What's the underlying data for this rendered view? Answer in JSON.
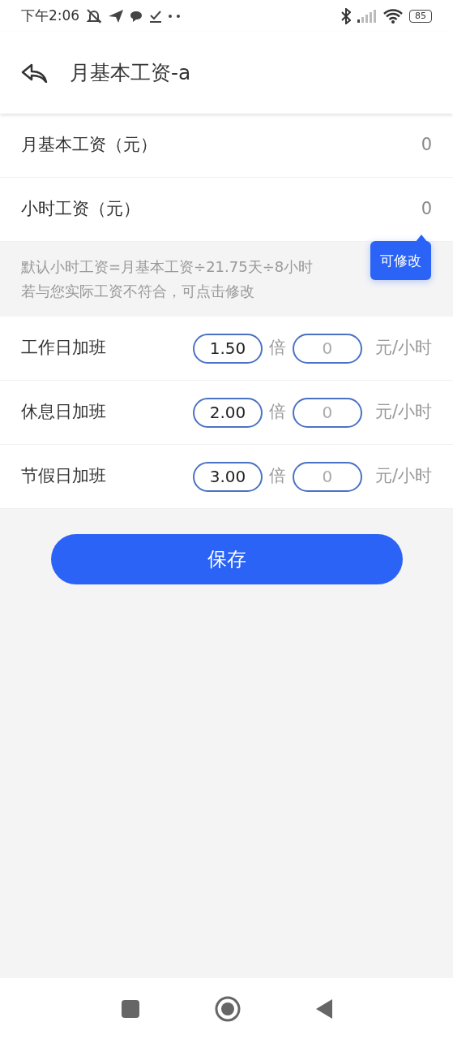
{
  "status_bar": {
    "time": "下午2:06",
    "battery": "85"
  },
  "header": {
    "title": "月基本工资-a"
  },
  "wage_rows": [
    {
      "label": "月基本工资（元）",
      "value": "0"
    },
    {
      "label": "小时工资（元）",
      "value": "0"
    }
  ],
  "tooltip": {
    "text": "可修改"
  },
  "info": {
    "lines": [
      "默认小时工资=月基本工资÷21.75天÷8小时",
      "若与您实际工资不符合，可点击修改"
    ]
  },
  "overtime_rows": [
    {
      "label": "工作日加班",
      "multiplier": "1.50",
      "times_label": "倍",
      "rate_placeholder": "0",
      "unit": "元/小时"
    },
    {
      "label": "休息日加班",
      "multiplier": "2.00",
      "times_label": "倍",
      "rate_placeholder": "0",
      "unit": "元/小时"
    },
    {
      "label": "节假日加班",
      "multiplier": "3.00",
      "times_label": "倍",
      "rate_placeholder": "0",
      "unit": "元/小时"
    }
  ],
  "save_button": {
    "label": "保存"
  }
}
